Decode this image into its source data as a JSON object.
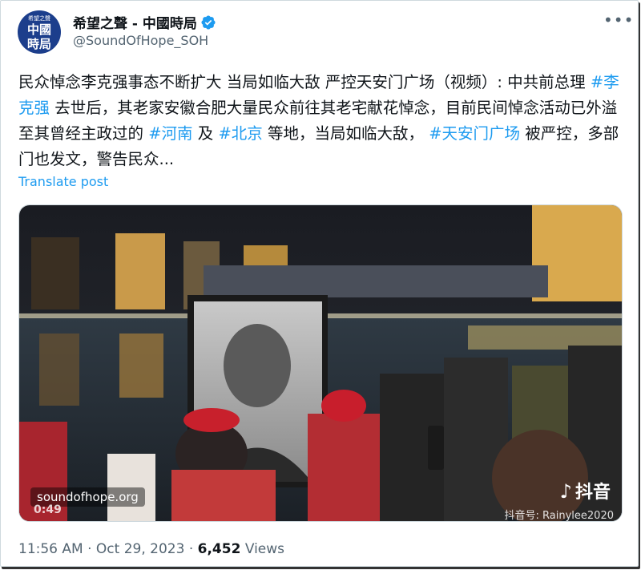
{
  "account": {
    "avatar_small": "希望之聲",
    "avatar_line1": "中國",
    "avatar_line2": "時局",
    "display_name": "希望之聲 - 中國時局",
    "handle": "@SoundOfHope_SOH",
    "more_icon": "more-horizontal-icon",
    "verified_color": "#1d9bf0"
  },
  "post": {
    "seg1": "民众悼念李克强事态不断扩大 当局如临大敌 严控天安门广场（视频）: 中共前总理 ",
    "tag1": "#李克强",
    "seg2": " 去世后，其老家安徽合肥大量民众前往其老宅献花悼念，目前民间悼念活动已外溢至其曾经主政过的 ",
    "tag2": "#河南",
    "seg3": " 及 ",
    "tag3": "#北京",
    "seg4": " 等地，当局如临大敌， ",
    "tag4": "#天安门广场",
    "seg5": " 被严控，多部门也发文，警告民众...",
    "translate": "Translate post"
  },
  "media": {
    "watermark": "soundofhope.org",
    "duration": "0:49",
    "tiktok_label": "抖音",
    "douyin_id": "抖音号: Rainylee2020"
  },
  "meta": {
    "time": "11:56 AM",
    "sep": " · ",
    "date": "Oct 29, 2023",
    "views_count": "6,452",
    "views_label": " Views"
  }
}
